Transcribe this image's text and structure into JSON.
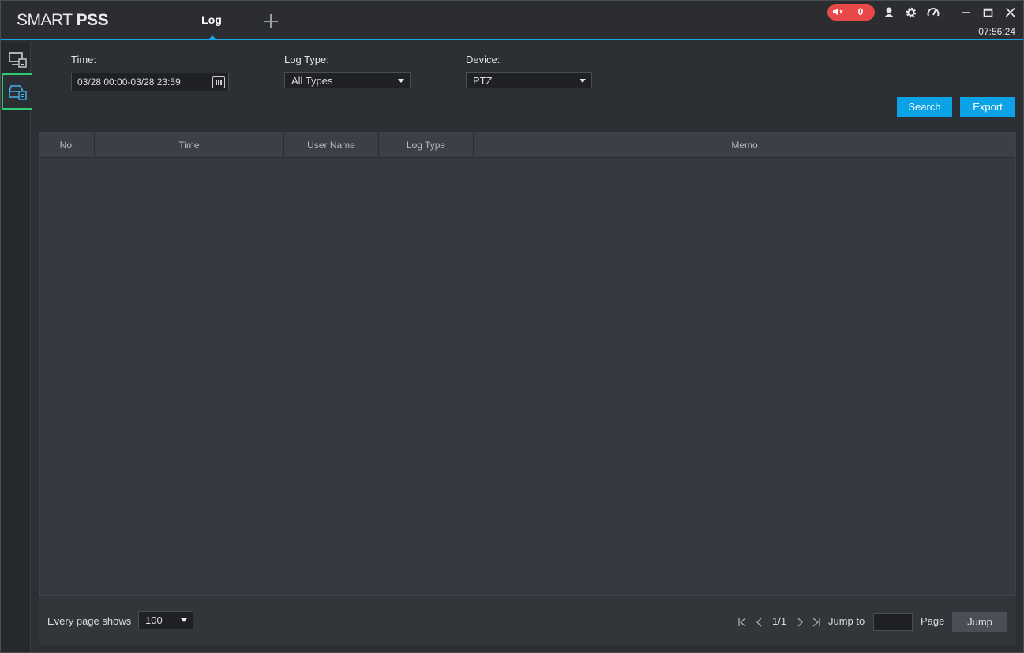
{
  "app": {
    "brand_light": "SMART ",
    "brand_bold": "PSS",
    "active_tab": "Log",
    "alarm_count": "0",
    "clock": "07:56:24",
    "accent_color": "#1aa3e8",
    "alarm_color": "#e84848"
  },
  "icons": {
    "add_tab": "plus-icon",
    "alarm": "speaker-mute-icon",
    "user": "user-icon",
    "settings": "gear-icon",
    "performance": "gauge-icon",
    "minimize": "minimize-icon",
    "maximize": "maximize-icon",
    "close": "close-icon"
  },
  "rail": [
    {
      "name": "device-log",
      "icon": "device-log-icon",
      "active": false
    },
    {
      "name": "client-log",
      "icon": "client-log-icon",
      "active": true
    }
  ],
  "filters": {
    "time_label": "Time:",
    "time_value": "03/28 00:00-03/28 23:59",
    "log_type_label": "Log Type:",
    "log_type_value": "All Types",
    "device_label": "Device:",
    "device_value": "PTZ"
  },
  "actions": {
    "search": "Search",
    "export": "Export"
  },
  "table": {
    "columns": [
      "No.",
      "Time",
      "User Name",
      "Log Type",
      "Memo"
    ],
    "rows": []
  },
  "pagination": {
    "every_page_label": "Every page shows",
    "page_size": "100",
    "page_indicator": "1/1",
    "jump_to_label": "Jump to",
    "jump_value": "",
    "page_label": "Page",
    "jump_button": "Jump"
  }
}
